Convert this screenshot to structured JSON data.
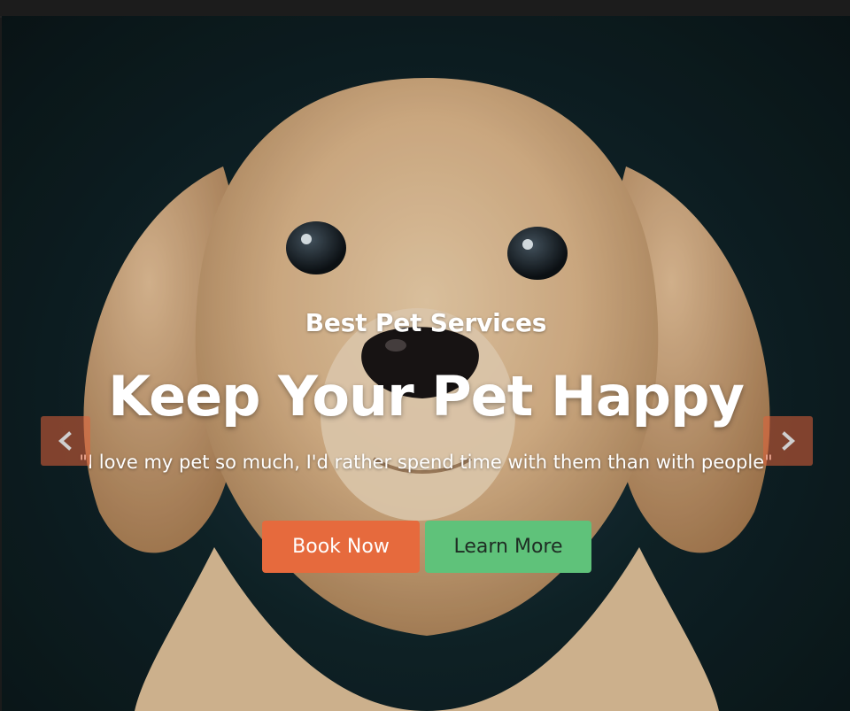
{
  "hero": {
    "subtitle": "Best Pet Services",
    "title": "Keep Your Pet Happy",
    "quote": "\"I love my pet so much, I'd rather spend time with them than with people\""
  },
  "buttons": {
    "book": "Book Now",
    "learn": "Learn More"
  },
  "carousel": {
    "prev_icon": "chevron-left-icon",
    "next_icon": "chevron-right-icon"
  },
  "colors": {
    "primary": "#e66a3d",
    "secondary": "#5fc27a"
  }
}
